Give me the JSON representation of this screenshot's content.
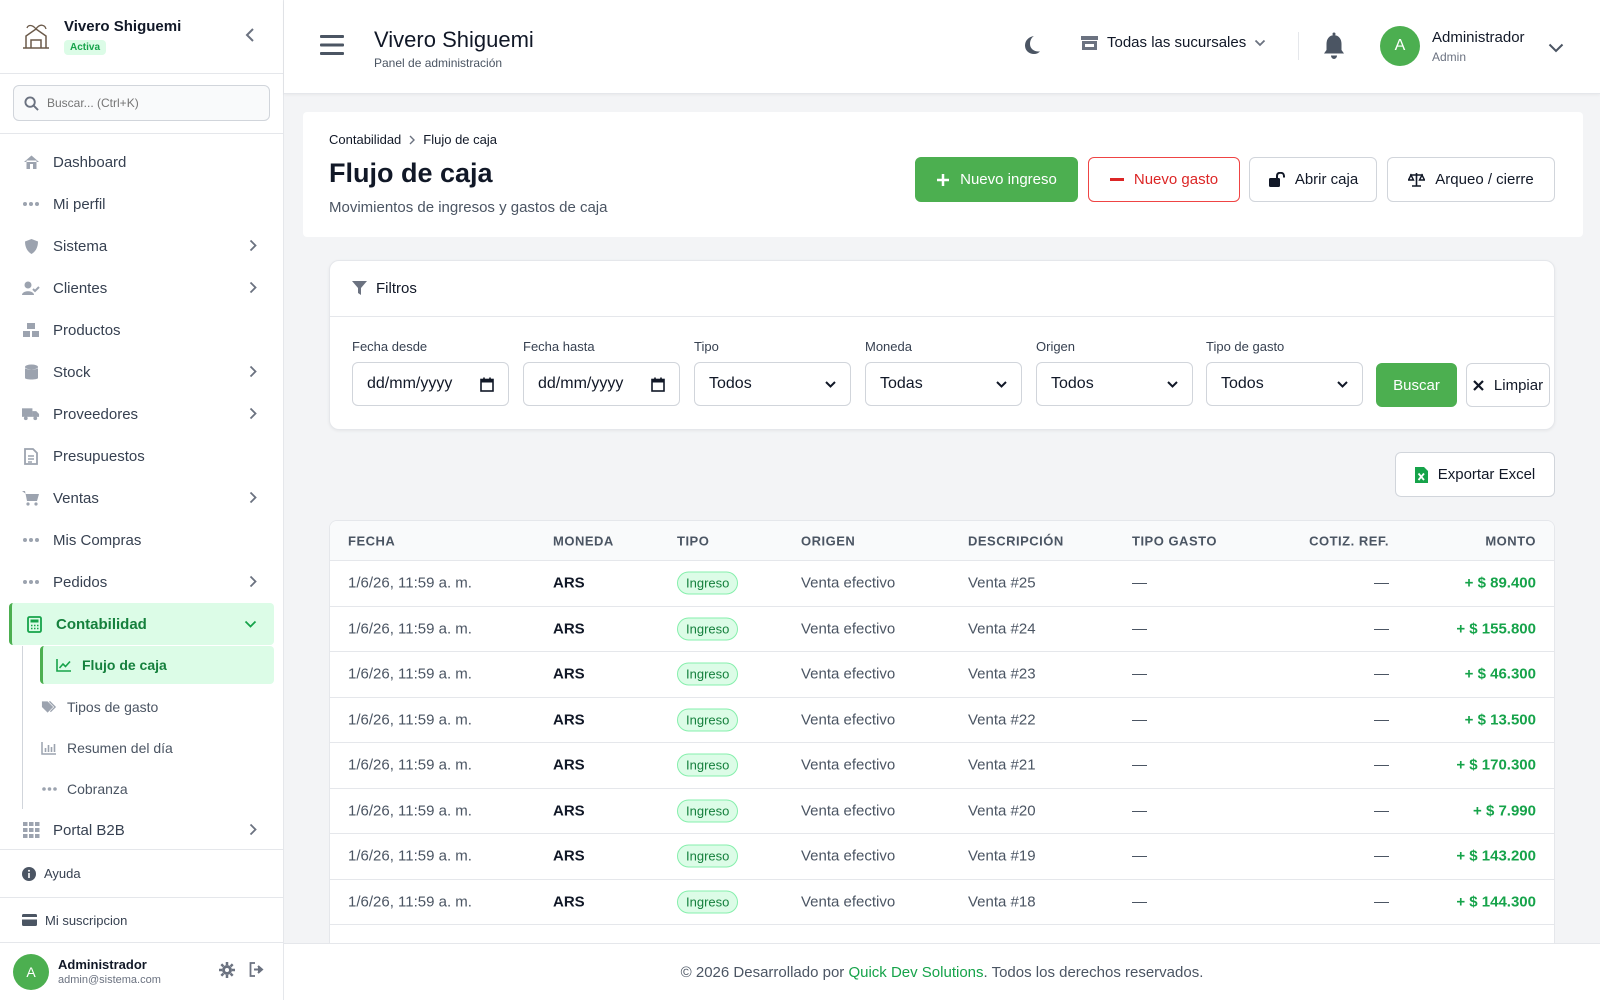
{
  "sidebar": {
    "brand_name": "Vivero Shiguemi",
    "brand_status": "Activa",
    "search_placeholder": "Buscar... (Ctrl+K)",
    "items": [
      {
        "label": "Dashboard",
        "icon": "home-icon",
        "has_children": false
      },
      {
        "label": "Mi perfil",
        "icon": "dots-icon",
        "has_children": false
      },
      {
        "label": "Sistema",
        "icon": "shield-icon",
        "has_children": true
      },
      {
        "label": "Clientes",
        "icon": "users-icon",
        "has_children": true
      },
      {
        "label": "Productos",
        "icon": "boxes-icon",
        "has_children": false
      },
      {
        "label": "Stock",
        "icon": "database-icon",
        "has_children": true
      },
      {
        "label": "Proveedores",
        "icon": "truck-icon",
        "has_children": true
      },
      {
        "label": "Presupuestos",
        "icon": "document-icon",
        "has_children": false
      },
      {
        "label": "Ventas",
        "icon": "cart-icon",
        "has_children": true
      },
      {
        "label": "Mis Compras",
        "icon": "dots-icon",
        "has_children": false
      },
      {
        "label": "Pedidos",
        "icon": "dots-icon",
        "has_children": true
      },
      {
        "label": "Contabilidad",
        "icon": "calculator-icon",
        "has_children": true,
        "expanded": true
      },
      {
        "label": "Portal B2B",
        "icon": "grid-icon",
        "has_children": true
      }
    ],
    "sub_items": [
      {
        "label": "Flujo de caja",
        "icon": "chart-line-icon",
        "active": true
      },
      {
        "label": "Tipos de gasto",
        "icon": "tags-icon"
      },
      {
        "label": "Resumen del día",
        "icon": "bar-chart-icon"
      },
      {
        "label": "Cobranza",
        "icon": "dots-icon"
      }
    ],
    "help_label": "Ayuda",
    "subscription_label": "Mi suscripcion",
    "user": {
      "initial": "A",
      "name": "Administrador",
      "email": "admin@sistema.com"
    }
  },
  "header": {
    "title": "Vivero Shiguemi",
    "subtitle": "Panel de administración",
    "branch_selector": "Todas las sucursales",
    "user_initial": "A",
    "user_name": "Administrador",
    "user_role": "Admin"
  },
  "page": {
    "breadcrumb": [
      "Contabilidad",
      "Flujo de caja"
    ],
    "title": "Flujo de caja",
    "subtitle": "Movimientos de ingresos y gastos de caja",
    "actions": {
      "new_income": "Nuevo ingreso",
      "new_expense": "Nuevo gasto",
      "open_cash": "Abrir caja",
      "close_cash": "Arqueo / cierre"
    }
  },
  "filters": {
    "title": "Filtros",
    "date_from": {
      "label": "Fecha desde",
      "value": "dd/mm/yyyy"
    },
    "date_to": {
      "label": "Fecha hasta",
      "value": "dd/mm/yyyy"
    },
    "tipo": {
      "label": "Tipo",
      "value": "Todos"
    },
    "moneda": {
      "label": "Moneda",
      "value": "Todas"
    },
    "origen": {
      "label": "Origen",
      "value": "Todos"
    },
    "tipo_gasto": {
      "label": "Tipo de gasto",
      "value": "Todos"
    },
    "search_button": "Buscar",
    "clear_button": "Limpiar"
  },
  "export_button": "Exportar Excel",
  "table": {
    "columns": [
      "FECHA",
      "MONEDA",
      "TIPO",
      "ORIGEN",
      "DESCRIPCIÓN",
      "TIPO GASTO",
      "COTIZ. REF.",
      "MONTO"
    ],
    "rows": [
      {
        "fecha": "1/6/26, 11:59 a. m.",
        "moneda": "ARS",
        "tipo": "Ingreso",
        "origen": "Venta efectivo",
        "descripcion": "Venta #25",
        "tipo_gasto": "—",
        "cotiz": "—",
        "monto": "+ $ 89.400"
      },
      {
        "fecha": "1/6/26, 11:59 a. m.",
        "moneda": "ARS",
        "tipo": "Ingreso",
        "origen": "Venta efectivo",
        "descripcion": "Venta #24",
        "tipo_gasto": "—",
        "cotiz": "—",
        "monto": "+ $ 155.800"
      },
      {
        "fecha": "1/6/26, 11:59 a. m.",
        "moneda": "ARS",
        "tipo": "Ingreso",
        "origen": "Venta efectivo",
        "descripcion": "Venta #23",
        "tipo_gasto": "—",
        "cotiz": "—",
        "monto": "+ $ 46.300"
      },
      {
        "fecha": "1/6/26, 11:59 a. m.",
        "moneda": "ARS",
        "tipo": "Ingreso",
        "origen": "Venta efectivo",
        "descripcion": "Venta #22",
        "tipo_gasto": "—",
        "cotiz": "—",
        "monto": "+ $ 13.500"
      },
      {
        "fecha": "1/6/26, 11:59 a. m.",
        "moneda": "ARS",
        "tipo": "Ingreso",
        "origen": "Venta efectivo",
        "descripcion": "Venta #21",
        "tipo_gasto": "—",
        "cotiz": "—",
        "monto": "+ $ 170.300"
      },
      {
        "fecha": "1/6/26, 11:59 a. m.",
        "moneda": "ARS",
        "tipo": "Ingreso",
        "origen": "Venta efectivo",
        "descripcion": "Venta #20",
        "tipo_gasto": "—",
        "cotiz": "—",
        "monto": "+ $ 7.990"
      },
      {
        "fecha": "1/6/26, 11:59 a. m.",
        "moneda": "ARS",
        "tipo": "Ingreso",
        "origen": "Venta efectivo",
        "descripcion": "Venta #19",
        "tipo_gasto": "—",
        "cotiz": "—",
        "monto": "+ $ 143.200"
      },
      {
        "fecha": "1/6/26, 11:59 a. m.",
        "moneda": "ARS",
        "tipo": "Ingreso",
        "origen": "Venta efectivo",
        "descripcion": "Venta #18",
        "tipo_gasto": "—",
        "cotiz": "—",
        "monto": "+ $ 144.300"
      }
    ]
  },
  "footer": {
    "prefix": "© 2026 Desarrollado por ",
    "link": "Quick Dev Solutions",
    "suffix": ". Todos los derechos reservados."
  },
  "colors": {
    "accent": "#4caf50",
    "danger": "#dc2626",
    "income": "#16a34a"
  }
}
